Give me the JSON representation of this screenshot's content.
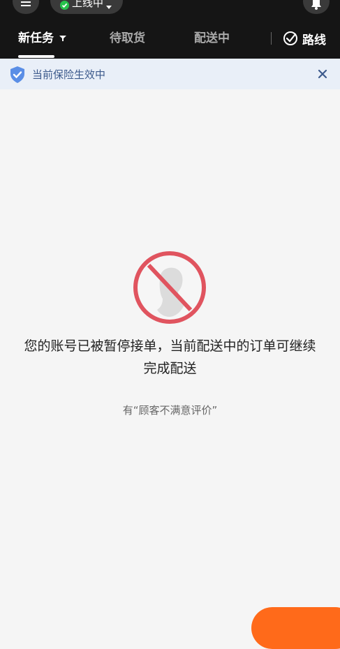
{
  "header": {
    "status_label": "上线中",
    "tabs": [
      {
        "label": "新任务",
        "active": true
      },
      {
        "label": "待取货",
        "active": false
      },
      {
        "label": "配送中",
        "active": false
      }
    ],
    "route_label": "路线",
    "icons": {
      "menu": "menu-icon",
      "dropdown": "caret-down-icon",
      "filter": "filter-icon",
      "bell": "bell-icon",
      "route": "route-icon"
    }
  },
  "banner": {
    "text": "当前保险生效中",
    "icon": "shield-check-icon",
    "close_icon": "close-icon"
  },
  "main": {
    "illustration": "no-person-icon",
    "message_line1": "您的账号已被暂停接单，当前配送中的订单可继续",
    "message_line2": "完成配送",
    "reason": "有“顾客不满意评价”"
  },
  "colors": {
    "header_bg": "#151515",
    "status_green": "#27c24c",
    "banner_bg": "#e9eff8",
    "banner_text": "#3c5a8c",
    "prohibit_red": "#e0545f",
    "accent_orange": "#ff6a1a"
  }
}
